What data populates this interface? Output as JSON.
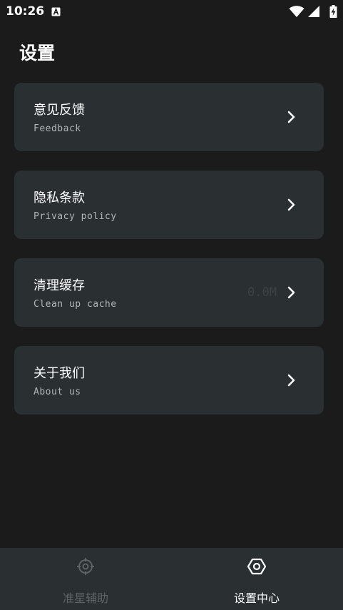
{
  "status_bar": {
    "time": "10:26",
    "notification_icon": "a-square-icon",
    "icons": [
      "wifi-icon",
      "signal-icon",
      "battery-charging-icon"
    ]
  },
  "page": {
    "title": "设置"
  },
  "settings": {
    "items": [
      {
        "title": "意见反馈",
        "subtitle": "Feedback",
        "value": ""
      },
      {
        "title": "隐私条款",
        "subtitle": "Privacy policy",
        "value": ""
      },
      {
        "title": "清理缓存",
        "subtitle": "Clean up cache",
        "value": "0.0M"
      },
      {
        "title": "关于我们",
        "subtitle": "About us",
        "value": ""
      }
    ]
  },
  "bottom_nav": {
    "tabs": [
      {
        "label": "准星辅助",
        "icon": "crosshair-icon",
        "active": false
      },
      {
        "label": "设置中心",
        "icon": "settings-hexagon-icon",
        "active": true
      }
    ]
  },
  "colors": {
    "background": "#1b1b1b",
    "card": "#2a2f32",
    "nav_bar": "#2a2f32",
    "active": "#ffffff",
    "inactive": "#5d6366"
  }
}
